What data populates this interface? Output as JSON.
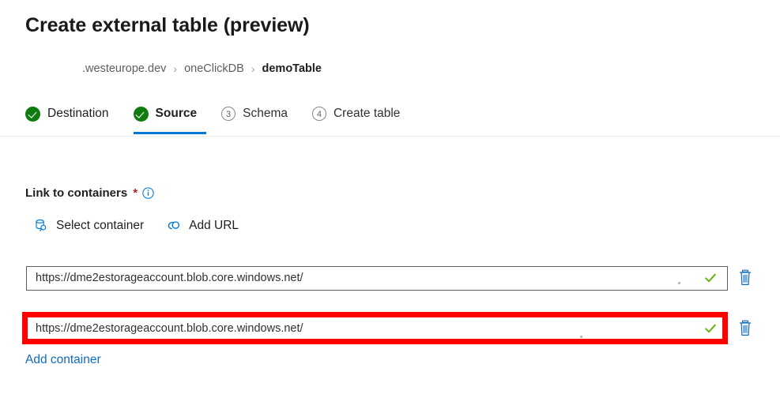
{
  "page": {
    "title": "Create external table (preview)"
  },
  "breadcrumb": {
    "separator": "›",
    "items": [
      {
        "label": ".westeurope.dev",
        "current": false
      },
      {
        "label": "oneClickDB",
        "current": false
      },
      {
        "label": "demoTable",
        "current": true
      }
    ]
  },
  "stepper": {
    "steps": [
      {
        "label": "Destination",
        "state": "complete",
        "number": "1"
      },
      {
        "label": "Source",
        "state": "complete-active",
        "number": "2"
      },
      {
        "label": "Schema",
        "state": "pending",
        "number": "3"
      },
      {
        "label": "Create table",
        "state": "pending",
        "number": "4"
      }
    ]
  },
  "form": {
    "field_label": "Link to containers",
    "required_marker": "*",
    "info_icon": "info-icon",
    "actions": [
      {
        "label": "Select container",
        "icon": "select-container-icon"
      },
      {
        "label": "Add URL",
        "icon": "link-icon"
      }
    ],
    "containers": [
      {
        "value": "https://dme2estorageaccount.blob.core.windows.net/",
        "placeholder": "https://",
        "valid": true,
        "highlighted": false,
        "delete_icon": "trash-icon",
        "valid_icon": "checkmark-icon"
      },
      {
        "value": "https://dme2estorageaccount.blob.core.windows.net/",
        "placeholder": "https://",
        "valid": true,
        "highlighted": true,
        "delete_icon": "trash-icon",
        "valid_icon": "checkmark-icon"
      }
    ],
    "add_container_label": "Add container"
  },
  "colors": {
    "accent": "#0078d4",
    "link": "#0f6cbd",
    "success": "#107c10",
    "check_green": "#5db300",
    "required": "#a4262c",
    "highlight": "#ff0000",
    "icon_blue": "#0078d4"
  }
}
